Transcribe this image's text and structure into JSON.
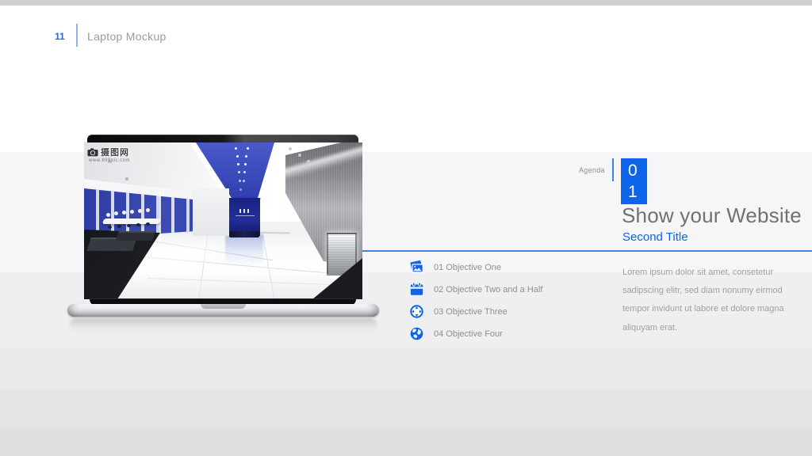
{
  "colors": {
    "accent_blue": "#0d64e8",
    "divider_blue": "#3b82ec",
    "title_gray": "#6f7174",
    "top_bar_gray": "#d0d0d2"
  },
  "header": {
    "page_number": "11",
    "slide_title": "Laptop Mockup"
  },
  "agenda": {
    "label": "Agenda",
    "chapter_digits": [
      "0",
      "1"
    ]
  },
  "titles": {
    "main": "Show your Website",
    "sub": "Second Title"
  },
  "objectives": [
    {
      "icon": "photos-icon",
      "label": "01 Objective One"
    },
    {
      "icon": "calendar-icon",
      "label": "02 Objective Two and a Half"
    },
    {
      "icon": "target-icon",
      "label": "03 Objective Three"
    },
    {
      "icon": "globe-icon",
      "label": "04 Objective Four"
    }
  ],
  "paragraph": {
    "lines": [
      "Lorem ipsum dolor sit amet, consetetur",
      "sadipscing elitr, sed diam nonumy eirmod",
      "tempor invidunt ut labore et dolore magna",
      "aliquyam erat."
    ]
  },
  "laptop": {
    "watermark": "摄图网",
    "watermark_sub": "www.699pic.com"
  }
}
